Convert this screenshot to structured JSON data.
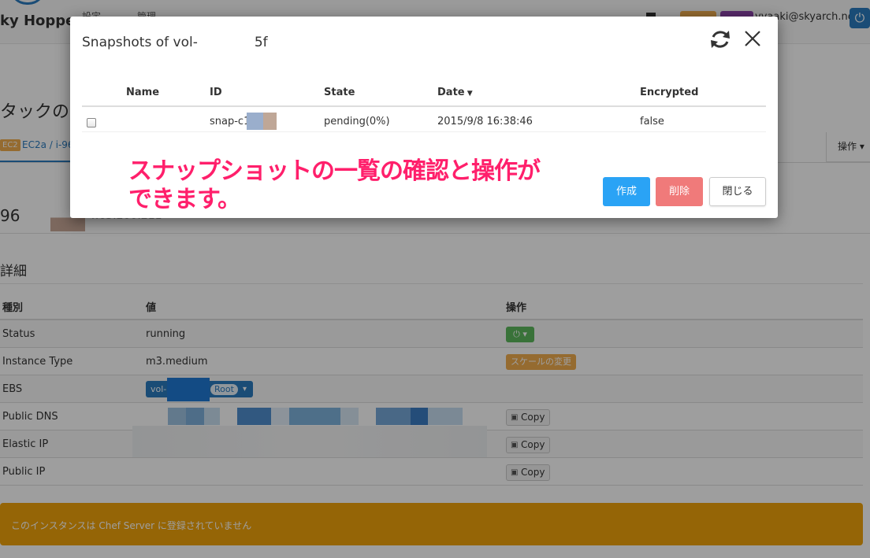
{
  "navbar": {
    "brand": "ky Hopper",
    "items": [
      "設定",
      "管理"
    ],
    "user": "vvaaki@skyarch.net",
    "badge_colors": [
      "#f0ad4e",
      "#8e44ad"
    ]
  },
  "page": {
    "title": "タックの",
    "tab_tag": "EC2",
    "tab_label": "EC2a / i-96",
    "ops_label": "操作",
    "instance_prefix": "96",
    "ip_text": "4.65.200.211"
  },
  "details": {
    "section_title": "詳細",
    "columns": [
      "種別",
      "値",
      "操作"
    ],
    "rows": [
      {
        "type": "Status",
        "value": "running"
      },
      {
        "type": "Instance Type",
        "value": "m3.medium",
        "action": "スケールの変更"
      },
      {
        "type": "EBS",
        "value": "vol-",
        "badge": "Root"
      },
      {
        "type": "Public DNS",
        "action": "Copy"
      },
      {
        "type": "Elastic IP",
        "action": "Copy"
      },
      {
        "type": "Public IP",
        "action": "Copy"
      }
    ]
  },
  "warning": "このインスタンスは Chef Server に登録されていません",
  "modal": {
    "title_prefix": "Snapshots of vol-",
    "title_suffix": "5f",
    "columns": {
      "name": "Name",
      "id": "ID",
      "state": "State",
      "date": "Date",
      "encrypted": "Encrypted"
    },
    "snapshots": [
      {
        "name": "",
        "id": "snap-c1",
        "state": "pending(0%)",
        "date": "2015/9/8 16:38:46",
        "encrypted": "false"
      }
    ],
    "buttons": {
      "create": "作成",
      "delete": "削除",
      "close": "閉じる"
    }
  },
  "annotation": {
    "line1": "スナップショットの一覧の確認と操作が",
    "line2": "できます。"
  },
  "colors": {
    "primary": "#2a7bbf",
    "create_button": "#2aa3f5",
    "delete_button": "#f07a7a",
    "warning": "#f0a30a",
    "annotation": "#ff1f6b",
    "status_green": "#5cb85c"
  }
}
